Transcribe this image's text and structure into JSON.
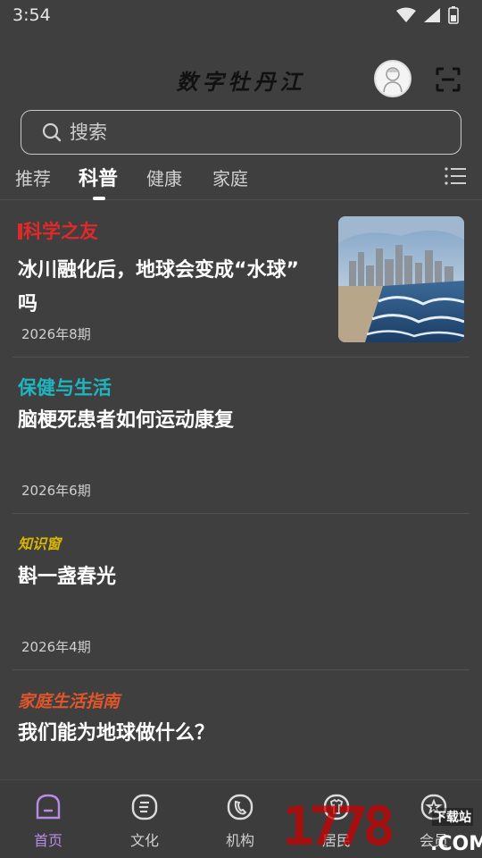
{
  "status_bar": {
    "time": "3:54"
  },
  "header": {
    "title": "数字牡丹江"
  },
  "search": {
    "placeholder": "搜索",
    "value": ""
  },
  "tabs": [
    {
      "label": "推荐",
      "active": false
    },
    {
      "label": "科普",
      "active": true
    },
    {
      "label": "健康",
      "active": false
    },
    {
      "label": "家庭",
      "active": false
    }
  ],
  "articles": [
    {
      "source": "科学之友",
      "title_line1": "冰川融化后，地球会变成“水球”",
      "title_line2": "吗",
      "date": "2026年8期"
    },
    {
      "source": "保健与生活",
      "title_line1": "脑梗死患者如何运动康复",
      "date": "2026年6期"
    },
    {
      "source": "知识窗",
      "title_line1": "斟一盏春光",
      "date": "2026年4期"
    },
    {
      "source": "家庭生活指南",
      "title_line1": "我们能为地球做什么？"
    }
  ],
  "bottom_nav": [
    {
      "label": "首页",
      "icon": "home-icon",
      "active": true
    },
    {
      "label": "文化",
      "icon": "culture-icon",
      "active": false
    },
    {
      "label": "机构",
      "icon": "institution-icon",
      "active": false
    },
    {
      "label": "居民",
      "icon": "resident-icon",
      "active": false
    },
    {
      "label": "会员",
      "icon": "member-icon",
      "active": false
    }
  ],
  "watermark": {
    "text": "1778",
    "subtext": "下载站",
    "suffix": ".COM"
  },
  "colors": {
    "background": "#3f3f3f",
    "accent": "#b98be8",
    "source_red": "#e02a2a",
    "source_teal": "#1fb5c0",
    "source_gold": "#d9b400",
    "source_orange": "#e0552a"
  }
}
